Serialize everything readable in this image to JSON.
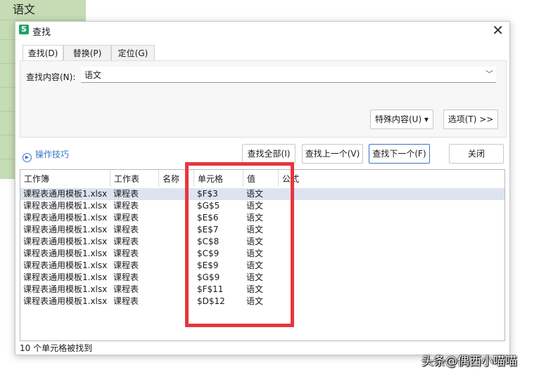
{
  "sheet": {
    "top_cell": "语文"
  },
  "dialog": {
    "title": "查找",
    "app_icon": "S",
    "close_glyph": "✕",
    "tabs": [
      {
        "label": "查找(D)"
      },
      {
        "label": "替换(P)"
      },
      {
        "label": "定位(G)"
      }
    ],
    "find": {
      "label": "查找内容(N):",
      "value": "语文"
    },
    "special_button": "特殊内容(U)",
    "options_button": "选项(T) >>",
    "tips_link": "操作技巧",
    "actions": {
      "find_all": "查找全部(I)",
      "find_prev": "查找上一个(V)",
      "find_next": "查找下一个(F)",
      "close": "关闭"
    },
    "columns": [
      "工作簿",
      "工作表",
      "名称",
      "单元格",
      "值",
      "公式"
    ],
    "rows": [
      {
        "workbook": "课程表通用模板1.xlsx",
        "sheet": "课程表",
        "name": "",
        "cell": "$F$3",
        "value": "语文"
      },
      {
        "workbook": "课程表通用模板1.xlsx",
        "sheet": "课程表",
        "name": "",
        "cell": "$G$5",
        "value": "语文"
      },
      {
        "workbook": "课程表通用模板1.xlsx",
        "sheet": "课程表",
        "name": "",
        "cell": "$E$6",
        "value": "语文"
      },
      {
        "workbook": "课程表通用模板1.xlsx",
        "sheet": "课程表",
        "name": "",
        "cell": "$E$7",
        "value": "语文"
      },
      {
        "workbook": "课程表通用模板1.xlsx",
        "sheet": "课程表",
        "name": "",
        "cell": "$C$8",
        "value": "语文"
      },
      {
        "workbook": "课程表通用模板1.xlsx",
        "sheet": "课程表",
        "name": "",
        "cell": "$C$9",
        "value": "语文"
      },
      {
        "workbook": "课程表通用模板1.xlsx",
        "sheet": "课程表",
        "name": "",
        "cell": "$E$9",
        "value": "语文"
      },
      {
        "workbook": "课程表通用模板1.xlsx",
        "sheet": "课程表",
        "name": "",
        "cell": "$G$9",
        "value": "语文"
      },
      {
        "workbook": "课程表通用模板1.xlsx",
        "sheet": "课程表",
        "name": "",
        "cell": "$F$11",
        "value": "语文"
      },
      {
        "workbook": "课程表通用模板1.xlsx",
        "sheet": "课程表",
        "name": "",
        "cell": "$D$12",
        "value": "语文"
      }
    ],
    "status": "10 个单元格被找到"
  },
  "watermark": "头条@偶西小喵喵",
  "colors": {
    "accent": "#3a74c6",
    "highlight": "#e8363c",
    "selected_row": "#dde4ef",
    "sheet_green": "#c6dcb4"
  }
}
